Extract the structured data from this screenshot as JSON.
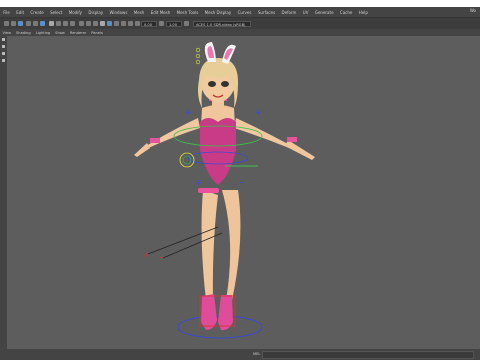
{
  "menubar": {
    "items": [
      "File",
      "Edit",
      "Create",
      "Select",
      "Modify",
      "Display",
      "Windows",
      "Mesh",
      "Edit Mesh",
      "Mesh Tools",
      "Mesh Display",
      "Curves",
      "Surfaces",
      "Deform",
      "UV",
      "Generate",
      "Cache",
      "Help"
    ],
    "right_label": "Wo"
  },
  "statusline": {
    "field1": "0.00",
    "field2": "1.00",
    "colorspace": "ACES 1.0 SDR-video (sRGB)"
  },
  "panelbar": {
    "items": [
      "View",
      "Shading",
      "Lighting",
      "Show",
      "Renderer",
      "Panels"
    ]
  },
  "viewport": {
    "background": "#5d5d5d",
    "gridline": "#6a6a6a",
    "body_color": "#f2c9a0",
    "suit_color": "#d43c8a",
    "hair_color": "#e8cf98",
    "control_blue": "#3e4ad0",
    "control_green": "#3ac24a",
    "control_red": "#d33"
  },
  "helpline": {
    "label": "MEL"
  }
}
